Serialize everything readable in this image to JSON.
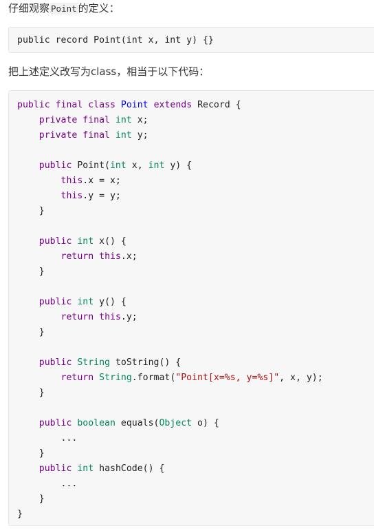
{
  "intro": {
    "prefix": "仔细观察",
    "code": "Point",
    "suffix": "的定义："
  },
  "record_code": [
    [
      {
        "t": "pl",
        "v": "public record Point(int x, int y) {}"
      }
    ]
  ],
  "second_paragraph": "把上述定义改写为class，相当于以下代码：",
  "class_code": [
    [
      {
        "t": "k",
        "v": "public"
      },
      {
        "t": "pl",
        "v": " "
      },
      {
        "t": "k",
        "v": "final"
      },
      {
        "t": "pl",
        "v": " "
      },
      {
        "t": "k",
        "v": "class"
      },
      {
        "t": "pl",
        "v": " "
      },
      {
        "t": "d",
        "v": "Point"
      },
      {
        "t": "pl",
        "v": " "
      },
      {
        "t": "k",
        "v": "extends"
      },
      {
        "t": "pl",
        "v": " Record {"
      }
    ],
    [
      {
        "t": "pl",
        "v": "    "
      },
      {
        "t": "k",
        "v": "private"
      },
      {
        "t": "pl",
        "v": " "
      },
      {
        "t": "k",
        "v": "final"
      },
      {
        "t": "pl",
        "v": " "
      },
      {
        "t": "t",
        "v": "int"
      },
      {
        "t": "pl",
        "v": " x;"
      }
    ],
    [
      {
        "t": "pl",
        "v": "    "
      },
      {
        "t": "k",
        "v": "private"
      },
      {
        "t": "pl",
        "v": " "
      },
      {
        "t": "k",
        "v": "final"
      },
      {
        "t": "pl",
        "v": " "
      },
      {
        "t": "t",
        "v": "int"
      },
      {
        "t": "pl",
        "v": " y;"
      }
    ],
    [],
    [
      {
        "t": "pl",
        "v": "    "
      },
      {
        "t": "k",
        "v": "public"
      },
      {
        "t": "pl",
        "v": " Point("
      },
      {
        "t": "t",
        "v": "int"
      },
      {
        "t": "pl",
        "v": " x, "
      },
      {
        "t": "t",
        "v": "int"
      },
      {
        "t": "pl",
        "v": " y) {"
      }
    ],
    [
      {
        "t": "pl",
        "v": "        "
      },
      {
        "t": "k",
        "v": "this"
      },
      {
        "t": "pl",
        "v": ".x = x;"
      }
    ],
    [
      {
        "t": "pl",
        "v": "        "
      },
      {
        "t": "k",
        "v": "this"
      },
      {
        "t": "pl",
        "v": ".y = y;"
      }
    ],
    [
      {
        "t": "pl",
        "v": "    }"
      }
    ],
    [],
    [
      {
        "t": "pl",
        "v": "    "
      },
      {
        "t": "k",
        "v": "public"
      },
      {
        "t": "pl",
        "v": " "
      },
      {
        "t": "t",
        "v": "int"
      },
      {
        "t": "pl",
        "v": " x() {"
      }
    ],
    [
      {
        "t": "pl",
        "v": "        "
      },
      {
        "t": "k",
        "v": "return"
      },
      {
        "t": "pl",
        "v": " "
      },
      {
        "t": "k",
        "v": "this"
      },
      {
        "t": "pl",
        "v": ".x;"
      }
    ],
    [
      {
        "t": "pl",
        "v": "    }"
      }
    ],
    [],
    [
      {
        "t": "pl",
        "v": "    "
      },
      {
        "t": "k",
        "v": "public"
      },
      {
        "t": "pl",
        "v": " "
      },
      {
        "t": "t",
        "v": "int"
      },
      {
        "t": "pl",
        "v": " y() {"
      }
    ],
    [
      {
        "t": "pl",
        "v": "        "
      },
      {
        "t": "k",
        "v": "return"
      },
      {
        "t": "pl",
        "v": " "
      },
      {
        "t": "k",
        "v": "this"
      },
      {
        "t": "pl",
        "v": ".y;"
      }
    ],
    [
      {
        "t": "pl",
        "v": "    }"
      }
    ],
    [],
    [
      {
        "t": "pl",
        "v": "    "
      },
      {
        "t": "k",
        "v": "public"
      },
      {
        "t": "pl",
        "v": " "
      },
      {
        "t": "t",
        "v": "String"
      },
      {
        "t": "pl",
        "v": " toString() {"
      }
    ],
    [
      {
        "t": "pl",
        "v": "        "
      },
      {
        "t": "k",
        "v": "return"
      },
      {
        "t": "pl",
        "v": " "
      },
      {
        "t": "t",
        "v": "String"
      },
      {
        "t": "pl",
        "v": ".format("
      },
      {
        "t": "s",
        "v": "\"Point[x=%s, y=%s]\""
      },
      {
        "t": "pl",
        "v": ", x, y);"
      }
    ],
    [
      {
        "t": "pl",
        "v": "    }"
      }
    ],
    [],
    [
      {
        "t": "pl",
        "v": "    "
      },
      {
        "t": "k",
        "v": "public"
      },
      {
        "t": "pl",
        "v": " "
      },
      {
        "t": "t",
        "v": "boolean"
      },
      {
        "t": "pl",
        "v": " equals("
      },
      {
        "t": "t",
        "v": "Object"
      },
      {
        "t": "pl",
        "v": " o) {"
      }
    ],
    [
      {
        "t": "pl",
        "v": "        ..."
      }
    ],
    [
      {
        "t": "pl",
        "v": "    }"
      }
    ],
    [
      {
        "t": "pl",
        "v": "    "
      },
      {
        "t": "k",
        "v": "public"
      },
      {
        "t": "pl",
        "v": " "
      },
      {
        "t": "t",
        "v": "int"
      },
      {
        "t": "pl",
        "v": " hashCode() {"
      }
    ],
    [
      {
        "t": "pl",
        "v": "        ..."
      }
    ],
    [
      {
        "t": "pl",
        "v": "    }"
      }
    ],
    [
      {
        "t": "pl",
        "v": "}"
      }
    ]
  ]
}
